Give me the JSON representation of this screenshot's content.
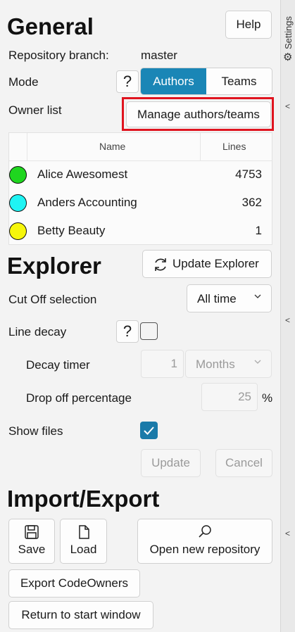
{
  "rail": {
    "label": "Settings",
    "gear": "⚙",
    "chevron": "<"
  },
  "general": {
    "title": "General",
    "help_label": "Help",
    "repo_branch_label": "Repository branch:",
    "repo_branch_value": "master",
    "mode_label": "Mode",
    "mode_help": "?",
    "mode_options": [
      {
        "label": "Authors",
        "selected": true
      },
      {
        "label": "Teams",
        "selected": false
      }
    ],
    "owner_list_label": "Owner list",
    "manage_button": "Manage authors/teams",
    "highlight_color": "#e0141f",
    "table": {
      "columns": [
        "Name",
        "Lines"
      ],
      "rows": [
        {
          "name": "Alice Awesomest",
          "lines": "4753",
          "color": "#1fd61f"
        },
        {
          "name": "Anders Accounting",
          "lines": "362",
          "color": "#1ff4f4"
        },
        {
          "name": "Betty Beauty",
          "lines": "1",
          "color": "#f6f60b"
        }
      ]
    }
  },
  "explorer": {
    "title": "Explorer",
    "update_button": "Update Explorer",
    "cutoff_label": "Cut Off selection",
    "cutoff_value": "All time",
    "line_decay_label": "Line decay",
    "line_decay_help": "?",
    "line_decay_checked": false,
    "decay_timer_label": "Decay timer",
    "decay_timer_value": "1",
    "decay_timer_unit": "Months",
    "dropoff_label": "Drop off percentage",
    "dropoff_value": "25",
    "dropoff_unit": "%",
    "show_files_label": "Show files",
    "show_files_checked": true,
    "update_label": "Update",
    "cancel_label": "Cancel"
  },
  "import_export": {
    "title": "Import/Export",
    "save_label": "Save",
    "load_label": "Load",
    "open_repo_label": "Open new repository",
    "export_codeowners_label": "Export CodeOwners",
    "return_label": "Return to start window"
  },
  "colors": {
    "accent": "#1a86b6",
    "checkbox_on": "#1a7aa9"
  }
}
